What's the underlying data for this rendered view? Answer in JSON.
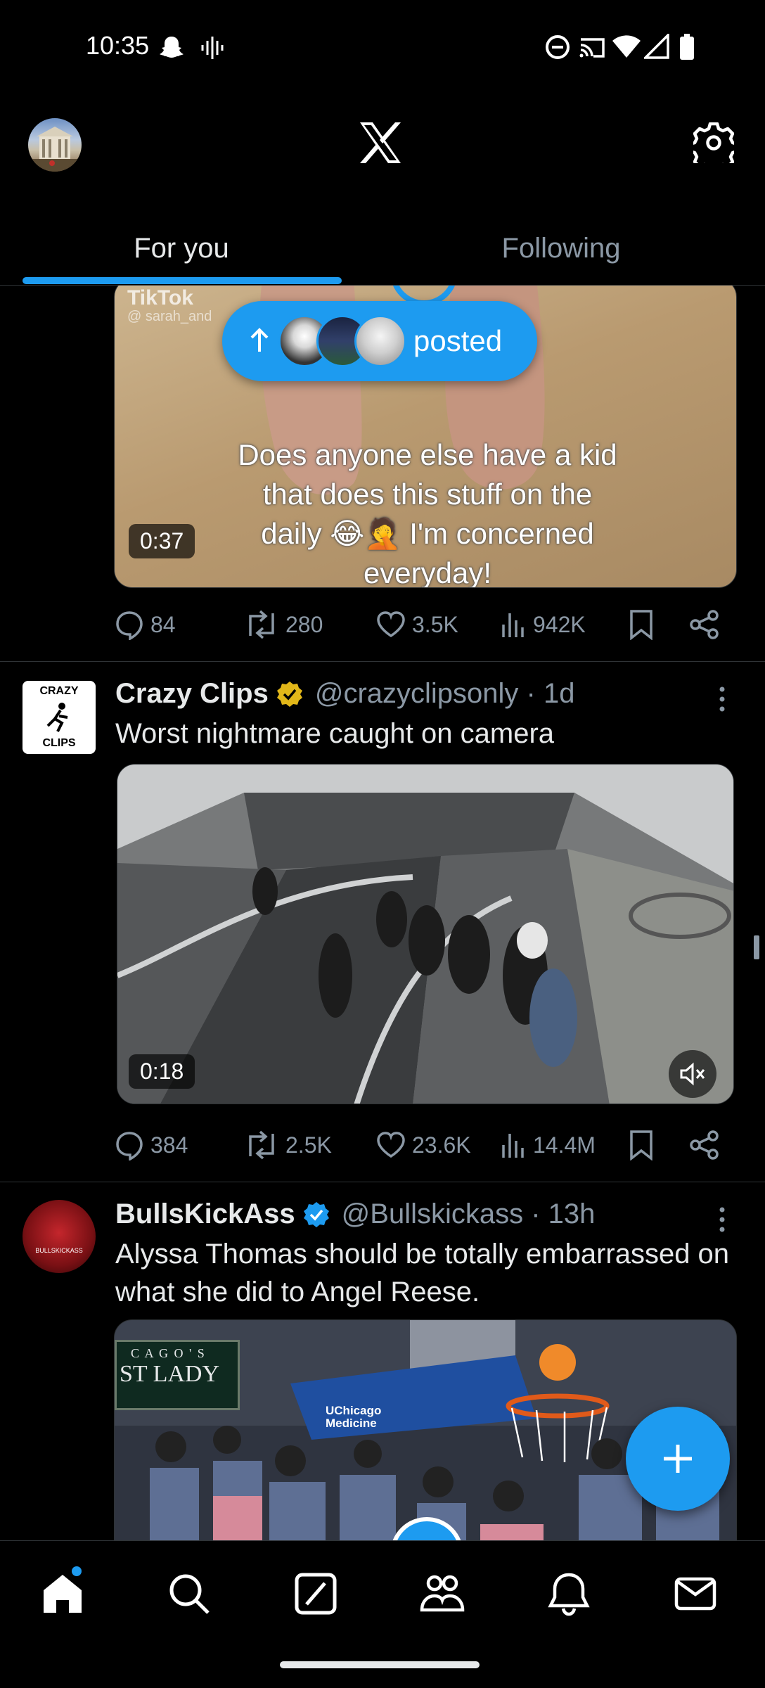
{
  "status_bar": {
    "time": "10:35",
    "icons": [
      "snapchat-icon",
      "voice-wave-icon",
      "dnd-icon",
      "cast-icon",
      "wifi-icon",
      "signal-icon",
      "battery-icon"
    ]
  },
  "top_bar": {
    "logo": "X",
    "settings_icon": "gear-icon"
  },
  "tabs": [
    {
      "label": "For you",
      "active": true
    },
    {
      "label": "Following",
      "active": false
    }
  ],
  "posted_pill": {
    "label": "posted"
  },
  "posts": [
    {
      "media": {
        "watermark": "TikTok",
        "watermark_user": "@ sarah_and",
        "caption_lines": [
          "Does anyone else have a kid",
          "that does this stuff on the",
          "daily 😂🤦 I'm concerned",
          "everyday!"
        ],
        "duration": "0:37"
      },
      "stats": {
        "replies": "84",
        "reposts": "280",
        "likes": "3.5K",
        "views": "942K"
      }
    },
    {
      "author": "Crazy Clips",
      "avatar_text": [
        "CRAZY",
        "CLIPS"
      ],
      "verified": "gold",
      "handle": "@crazyclipsonly · 1d",
      "text": "Worst nightmare caught on camera",
      "media": {
        "duration": "0:18",
        "muted": true
      },
      "stats": {
        "replies": "384",
        "reposts": "2.5K",
        "likes": "23.6K",
        "views": "14.4M"
      }
    },
    {
      "author": "BullsKickAss",
      "avatar_text": [
        "BULLSKICKASS"
      ],
      "verified": "blue",
      "handle": "@Bullskickass · 13h",
      "text": "Alyssa Thomas should be totally embarrassed on what she did to Angel Reese.",
      "media": {
        "sign_top": "C A G O ' S",
        "sign_main": "ST LADY",
        "banner": "UChicago Medicine"
      }
    }
  ],
  "bottom_nav": [
    "home-icon",
    "search-icon",
    "grok-icon",
    "communities-icon",
    "notifications-icon",
    "messages-icon"
  ],
  "colors": {
    "accent": "#1d9bf0",
    "background": "#000000",
    "muted": "#8b98a5",
    "gold": "#e2b719"
  }
}
